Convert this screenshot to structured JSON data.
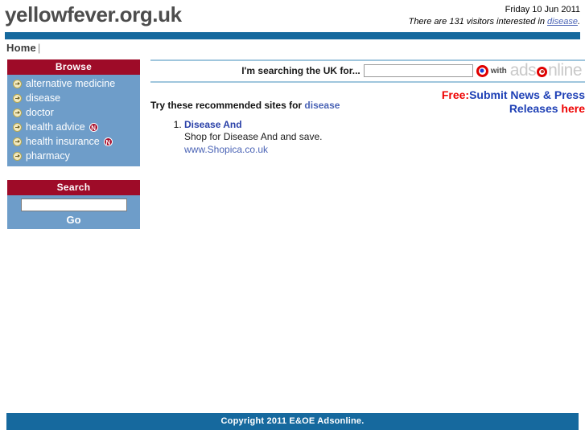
{
  "header": {
    "site_title": "yellowfever.org.uk",
    "date": "Friday 10 Jun 2011",
    "visitors_prefix": "There are 131 visitors interested in ",
    "visitors_keyword": "disease",
    "visitors_suffix": ".",
    "visitor_count": 131
  },
  "nav": {
    "home_label": "Home",
    "separator": "|"
  },
  "sidebar": {
    "browse": {
      "title": "Browse",
      "items": [
        {
          "label": "alternative medicine",
          "badge": ""
        },
        {
          "label": "disease",
          "badge": ""
        },
        {
          "label": "doctor",
          "badge": ""
        },
        {
          "label": "health advice",
          "badge": "N"
        },
        {
          "label": "health insurance",
          "badge": "N"
        },
        {
          "label": "pharmacy",
          "badge": ""
        }
      ]
    },
    "search": {
      "title": "Search",
      "input_value": "",
      "input_placeholder": "",
      "go_label": "Go"
    }
  },
  "main": {
    "searchbar": {
      "label": "I'm searching the UK for...",
      "input_value": "",
      "input_placeholder": "",
      "with_label": "with",
      "brand_part1": "ads",
      "brand_part2": "nline",
      "target_icon": "target-radio-icon"
    },
    "promo": {
      "free_label": "Free:",
      "body_label": "Submit News & Press Releases ",
      "here_label": "here"
    },
    "recommend": {
      "prefix": "Try these recommended sites for ",
      "keyword": "disease"
    },
    "results": [
      {
        "title": "Disease And",
        "description": "Shop for Disease And and save.",
        "url": "www.Shopica.co.uk"
      }
    ]
  },
  "footer": {
    "copyright": "Copyright 2011 E&OE Adsonline."
  },
  "colors": {
    "bar_blue": "#16699e",
    "panel_red": "#9e0b28",
    "panel_blue": "#6e9dc9",
    "link_blue": "#4a63b5",
    "promo_red": "#ee0000",
    "promo_blue": "#1d3fb5"
  }
}
